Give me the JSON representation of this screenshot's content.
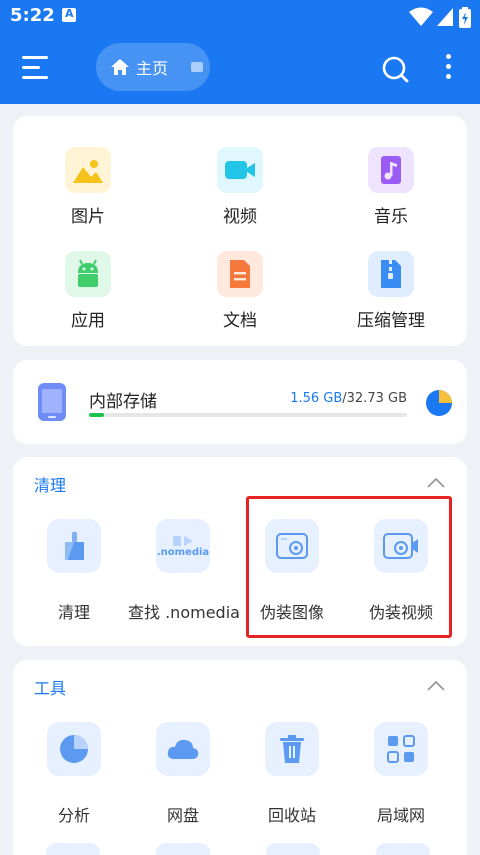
{
  "status_bar": {
    "time": "5:22"
  },
  "app_bar": {
    "breadcrumb_label": "主页"
  },
  "categories": [
    {
      "label": "图片",
      "icon": "image-icon",
      "color": "#f5c21b",
      "bg": "#fff5d6"
    },
    {
      "label": "视频",
      "icon": "video-icon",
      "color": "#22c4e8",
      "bg": "#dff7fd"
    },
    {
      "label": "音乐",
      "icon": "music-icon",
      "color": "#9b5cf5",
      "bg": "#efe4ff"
    },
    {
      "label": "应用",
      "icon": "android-icon",
      "color": "#3fce6b",
      "bg": "#e0f8e8"
    },
    {
      "label": "文档",
      "icon": "document-icon",
      "color": "#f5783c",
      "bg": "#ffe8dc"
    },
    {
      "label": "压缩管理",
      "icon": "archive-icon",
      "color": "#3a8cf5",
      "bg": "#e0edff"
    }
  ],
  "storage": {
    "title": "内部存储",
    "used": "1.56 GB",
    "separator": "/",
    "total": "32.73 GB",
    "used_fraction": 0.048
  },
  "clean_section": {
    "title": "清理",
    "items": [
      {
        "label": "清理",
        "icon": "broom-icon"
      },
      {
        "label": "查找 .nomedia",
        "icon": "nomedia-icon",
        "icon_text": ".nomedia"
      },
      {
        "label": "伪装图像",
        "icon": "disguise-image-icon"
      },
      {
        "label": "伪装视频",
        "icon": "disguise-video-icon"
      }
    ]
  },
  "tools_section": {
    "title": "工具",
    "items": [
      {
        "label": "分析",
        "icon": "analysis-pie-icon"
      },
      {
        "label": "网盘",
        "icon": "cloud-icon"
      },
      {
        "label": "回收站",
        "icon": "trash-icon"
      },
      {
        "label": "局域网",
        "icon": "lan-icon"
      }
    ]
  },
  "colors": {
    "accent": "#1a78f2",
    "highlight": "#e62222",
    "progress": "#19c24a"
  }
}
